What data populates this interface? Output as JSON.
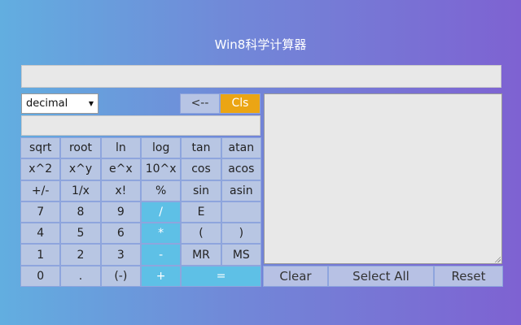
{
  "app": {
    "title": "Win8科学计算器"
  },
  "display": {
    "main_value": "",
    "sub_value": ""
  },
  "mode": {
    "selected": "decimal"
  },
  "controls": {
    "back_label": "<--",
    "cls_label": "Cls"
  },
  "keys": [
    [
      "sqrt",
      "root",
      "ln",
      "log",
      "tan",
      "atan"
    ],
    [
      "x^2",
      "x^y",
      "e^x",
      "10^x",
      "cos",
      "acos"
    ],
    [
      "+/-",
      "1/x",
      "x!",
      "%",
      "sin",
      "asin"
    ],
    [
      "7",
      "8",
      "9",
      "/",
      "E",
      ""
    ],
    [
      "4",
      "5",
      "6",
      "*",
      "(",
      ")"
    ],
    [
      "1",
      "2",
      "3",
      "-",
      "MR",
      "MS"
    ],
    [
      "0",
      ".",
      "(-)",
      "+",
      "="
    ]
  ],
  "history": {
    "content": ""
  },
  "history_buttons": {
    "clear": "Clear",
    "select_all": "Select All",
    "reset": "Reset"
  },
  "colors": {
    "accent_orange": "#eba514",
    "operator_blue": "#5ec0e6",
    "key_bg": "#b8c6e3"
  }
}
